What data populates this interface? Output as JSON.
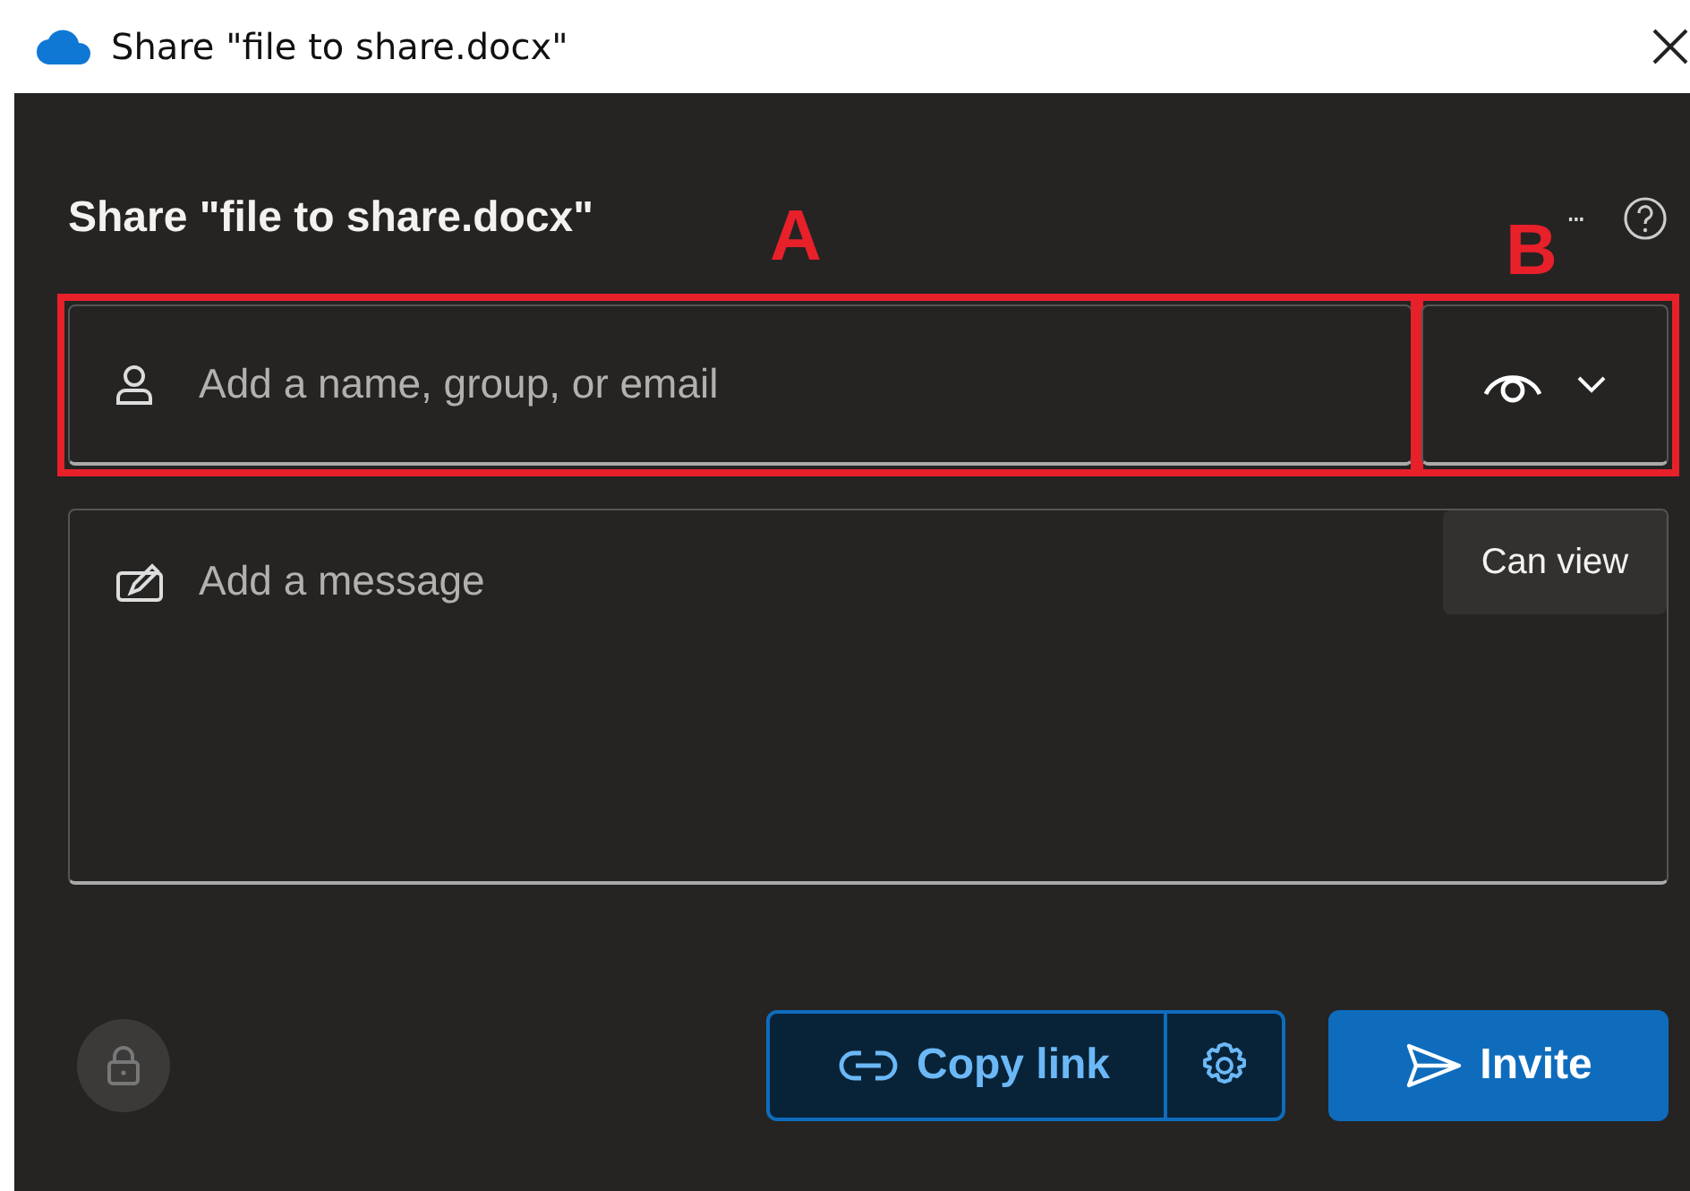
{
  "window": {
    "title": "Share \"file to share.docx\""
  },
  "dialog": {
    "heading": "Share \"file to share.docx\"",
    "more": "···"
  },
  "recipients": {
    "placeholder": "Add a name, group, or email",
    "annotation": "A"
  },
  "permission": {
    "tooltip": "Can view",
    "annotation": "B"
  },
  "message": {
    "placeholder": "Add a message"
  },
  "buttons": {
    "copy_link": "Copy link",
    "invite": "Invite"
  }
}
